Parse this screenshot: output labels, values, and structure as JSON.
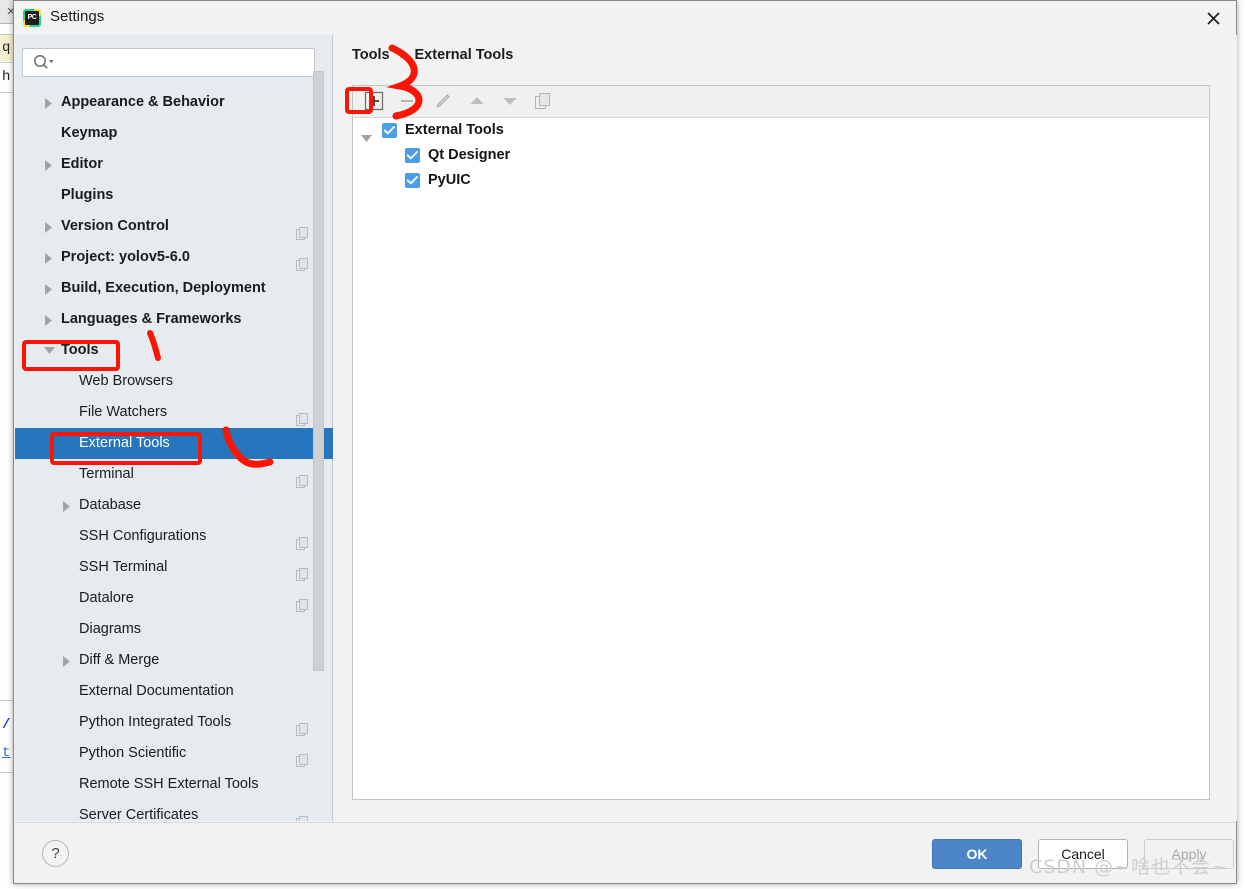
{
  "window": {
    "title": "Settings",
    "app_icon": "pycharm-logo-icon",
    "icon_text": "PC",
    "close_icon": "close-icon"
  },
  "search": {
    "value": "",
    "placeholder": "",
    "icon": "search-icon",
    "dropdown_icon": "chevron-down-icon"
  },
  "sidebar": {
    "items": [
      {
        "label": "Appearance & Behavior",
        "level": 0,
        "twisty": "collapsed",
        "selected": false,
        "copy_icon": false
      },
      {
        "label": "Keymap",
        "level": 0,
        "twisty": "none",
        "selected": false,
        "copy_icon": false
      },
      {
        "label": "Editor",
        "level": 0,
        "twisty": "collapsed",
        "selected": false,
        "copy_icon": false
      },
      {
        "label": "Plugins",
        "level": 0,
        "twisty": "none",
        "selected": false,
        "copy_icon": false
      },
      {
        "label": "Version Control",
        "level": 0,
        "twisty": "collapsed",
        "selected": false,
        "copy_icon": true
      },
      {
        "label": "Project: yolov5-6.0",
        "level": 0,
        "twisty": "collapsed",
        "selected": false,
        "copy_icon": true
      },
      {
        "label": "Build, Execution, Deployment",
        "level": 0,
        "twisty": "collapsed",
        "selected": false,
        "copy_icon": false
      },
      {
        "label": "Languages & Frameworks",
        "level": 0,
        "twisty": "collapsed",
        "selected": false,
        "copy_icon": false
      },
      {
        "label": "Tools",
        "level": 0,
        "twisty": "expanded",
        "selected": false,
        "copy_icon": false
      },
      {
        "label": "Web Browsers",
        "level": 1,
        "twisty": "none",
        "selected": false,
        "copy_icon": false
      },
      {
        "label": "File Watchers",
        "level": 1,
        "twisty": "none",
        "selected": false,
        "copy_icon": true
      },
      {
        "label": "External Tools",
        "level": 1,
        "twisty": "none",
        "selected": true,
        "copy_icon": false
      },
      {
        "label": "Terminal",
        "level": 1,
        "twisty": "none",
        "selected": false,
        "copy_icon": true
      },
      {
        "label": "Database",
        "level": 1,
        "twisty": "collapsed",
        "selected": false,
        "copy_icon": false
      },
      {
        "label": "SSH Configurations",
        "level": 1,
        "twisty": "none",
        "selected": false,
        "copy_icon": true
      },
      {
        "label": "SSH Terminal",
        "level": 1,
        "twisty": "none",
        "selected": false,
        "copy_icon": true
      },
      {
        "label": "Datalore",
        "level": 1,
        "twisty": "none",
        "selected": false,
        "copy_icon": true
      },
      {
        "label": "Diagrams",
        "level": 1,
        "twisty": "none",
        "selected": false,
        "copy_icon": false
      },
      {
        "label": "Diff & Merge",
        "level": 1,
        "twisty": "collapsed",
        "selected": false,
        "copy_icon": false
      },
      {
        "label": "External Documentation",
        "level": 1,
        "twisty": "none",
        "selected": false,
        "copy_icon": false
      },
      {
        "label": "Python Integrated Tools",
        "level": 1,
        "twisty": "none",
        "selected": false,
        "copy_icon": true
      },
      {
        "label": "Python Scientific",
        "level": 1,
        "twisty": "none",
        "selected": false,
        "copy_icon": true
      },
      {
        "label": "Remote SSH External Tools",
        "level": 1,
        "twisty": "none",
        "selected": false,
        "copy_icon": false
      },
      {
        "label": "Server Certificates",
        "level": 1,
        "twisty": "none",
        "selected": false,
        "copy_icon": true
      }
    ]
  },
  "main": {
    "breadcrumb": {
      "parent": "Tools",
      "separator": "›",
      "current": "External Tools"
    },
    "toolbar": [
      {
        "name": "add-button",
        "icon": "plus-icon",
        "enabled": true,
        "highlighted": true
      },
      {
        "name": "remove-button",
        "icon": "minus-icon",
        "enabled": false,
        "highlighted": false
      },
      {
        "name": "edit-button",
        "icon": "pencil-icon",
        "enabled": false,
        "highlighted": false
      },
      {
        "name": "move-up-button",
        "icon": "arrow-up-icon",
        "enabled": false,
        "highlighted": false
      },
      {
        "name": "move-down-button",
        "icon": "arrow-down-icon",
        "enabled": false,
        "highlighted": false
      },
      {
        "name": "copy-button",
        "icon": "copy-icon",
        "enabled": false,
        "highlighted": false
      }
    ],
    "tree": [
      {
        "label": "External Tools",
        "level": 0,
        "checked": true,
        "twisty": "expanded"
      },
      {
        "label": "Qt Designer",
        "level": 1,
        "checked": true,
        "twisty": "none"
      },
      {
        "label": "PyUIC",
        "level": 1,
        "checked": true,
        "twisty": "none"
      }
    ]
  },
  "footer": {
    "help_label": "?",
    "ok_label": "OK",
    "cancel_label": "Cancel",
    "apply_label": "Apply"
  },
  "watermark": "CSDN @~啥也不会~",
  "colors": {
    "selection_blue": "#2675bd",
    "checkbox_blue": "#4a9de8",
    "ok_blue": "#4a86c8",
    "annotation_red": "#fc1405",
    "sidebar_bg": "#e6ebef",
    "dialog_bg": "#f2f2f2"
  },
  "background_editor": {
    "lines": [
      "q",
      "h",
      "/",
      "t"
    ]
  }
}
